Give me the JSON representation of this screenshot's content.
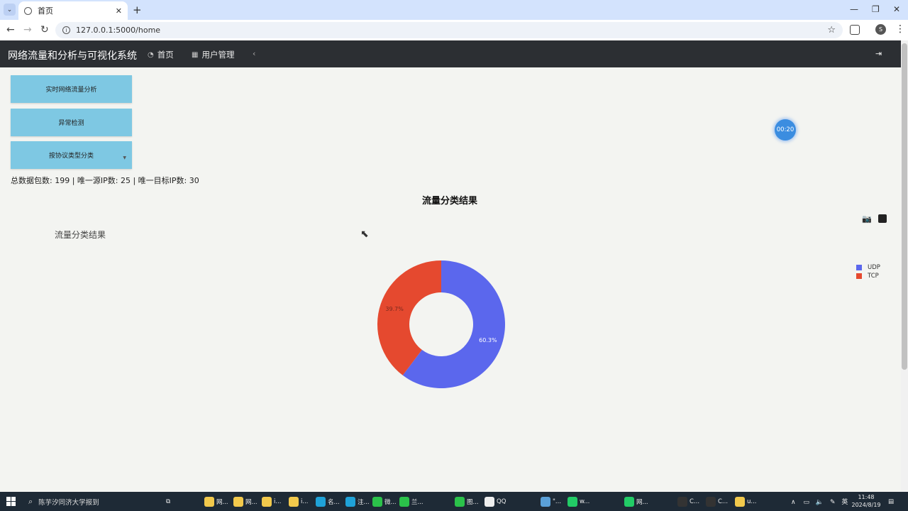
{
  "browser": {
    "tab_title": "首页",
    "url": "127.0.0.1:5000/home"
  },
  "navbar": {
    "brand": "网络流量和分析与可视化系统",
    "links": [
      {
        "label": "首页",
        "icon": "dashboard-icon"
      },
      {
        "label": "用户管理",
        "icon": "table-icon"
      }
    ]
  },
  "sidebar": {
    "buttons": [
      {
        "label": "实时网络流量分析"
      },
      {
        "label": "异常检测"
      },
      {
        "label": "按协议类型分类"
      }
    ]
  },
  "stats_text": "总数据包数: 199 | 唯一源IP数: 25 | 唯一目标IP数: 30",
  "timer": "00:20",
  "section_heading": "流量分类结果",
  "chart_data": {
    "type": "pie",
    "title": "流量分类结果",
    "variant": "donut",
    "legend_position": "right",
    "slices": [
      {
        "label": "UDP",
        "value": 60.3,
        "display": "60.3%",
        "color": "#5b67ed"
      },
      {
        "label": "TCP",
        "value": 39.7,
        "display": "39.7%",
        "color": "#e5492f"
      }
    ]
  },
  "taskbar": {
    "search_text": "陈芋汐同济大学报到",
    "items": [
      "网...",
      "网...",
      "i...",
      "i...",
      "名...",
      "注...",
      "微...",
      "兰...",
      "图...",
      "QQ",
      "\"...",
      "w...",
      "网...",
      "C...",
      "C...",
      "u..."
    ],
    "tray_lang": "英",
    "time": "11:48",
    "date": "2024/8/19"
  }
}
